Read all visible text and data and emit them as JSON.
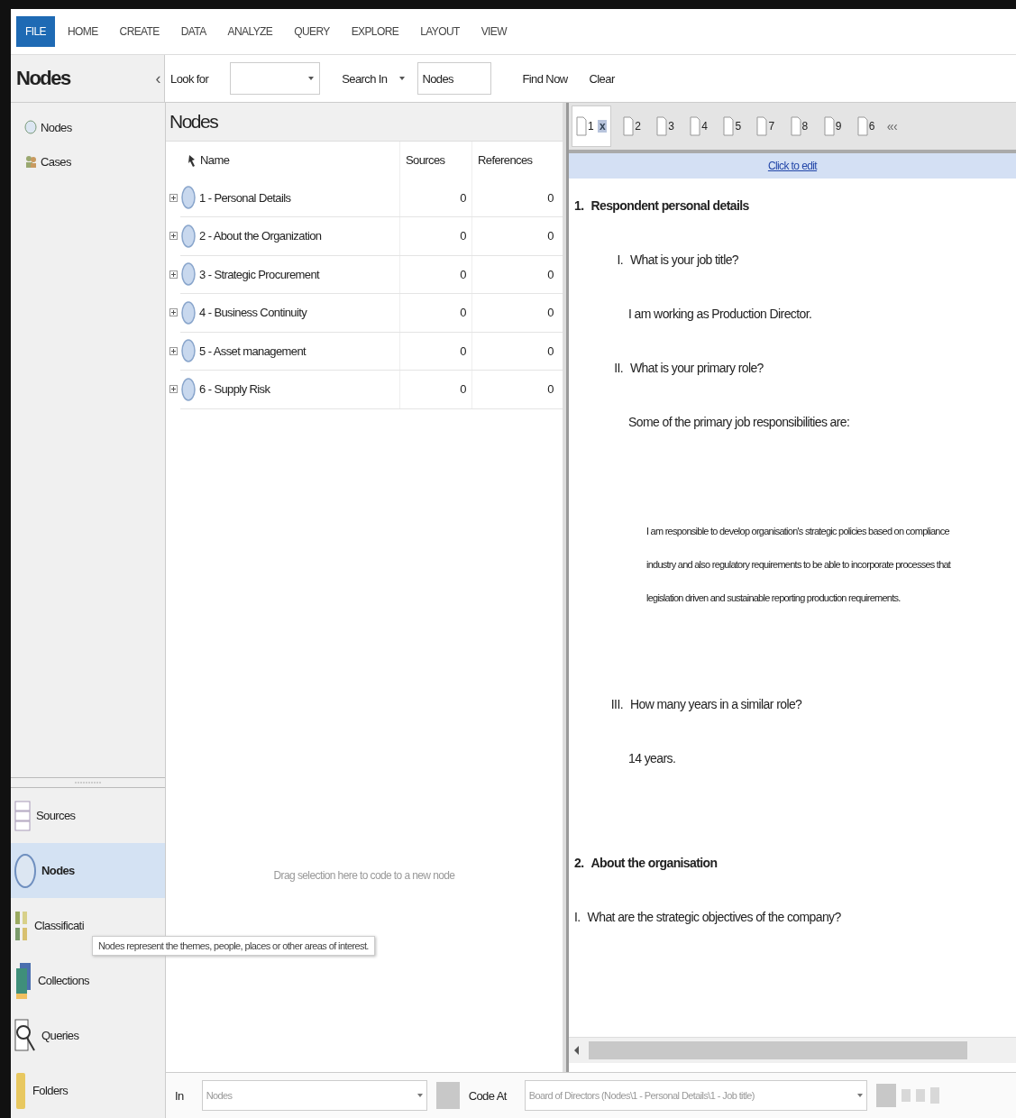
{
  "ribbon_tabs": [
    {
      "label": "FILE",
      "selected": true
    },
    {
      "label": "HOME",
      "selected": false
    },
    {
      "label": "CREATE",
      "selected": false
    },
    {
      "label": "DATA",
      "selected": false
    },
    {
      "label": "ANALYZE",
      "selected": false
    },
    {
      "label": "QUERY",
      "selected": false
    },
    {
      "label": "EXPLORE",
      "selected": false
    },
    {
      "label": "LAYOUT",
      "selected": false
    },
    {
      "label": "VIEW",
      "selected": false
    }
  ],
  "navigation": {
    "title": "Nodes",
    "collapse": "‹",
    "tree": [
      {
        "label": "Nodes",
        "selected": false,
        "kind": "nodes"
      },
      {
        "label": "Cases",
        "selected": false,
        "kind": "cases"
      }
    ],
    "sections": [
      {
        "label": "Sources",
        "selected": false,
        "kind": "sources"
      },
      {
        "label": "Nodes",
        "selected": true,
        "kind": "nodes"
      },
      {
        "label": "Classificati",
        "selected": false,
        "kind": "classifications"
      },
      {
        "label": "Collections",
        "selected": false,
        "kind": "collections"
      },
      {
        "label": "Queries",
        "selected": false,
        "kind": "queries"
      },
      {
        "label": "Folders",
        "selected": false,
        "kind": "folders"
      }
    ]
  },
  "find_bar": {
    "look_for_label": "Look for",
    "search_in_label": "Search In",
    "search_in_value": "Nodes",
    "find_now": "Find Now",
    "clear": "Clear"
  },
  "nodes_list": {
    "title": "Nodes",
    "columns": [
      "Name",
      "Sources",
      "References"
    ],
    "rows": [
      {
        "name": "1 - Personal Details",
        "sources": "0",
        "references": "0"
      },
      {
        "name": "2 - About the Organization",
        "sources": "0",
        "references": "0"
      },
      {
        "name": "3 - Strategic Procurement",
        "sources": "0",
        "references": "0"
      },
      {
        "name": "4 - Business Continuity",
        "sources": "0",
        "references": "0"
      },
      {
        "name": "5 - Asset management",
        "sources": "0",
        "references": "0"
      },
      {
        "name": "6 - Supply Risk",
        "sources": "0",
        "references": "0"
      }
    ],
    "drop_hint": "Drag selection here to code to a new node"
  },
  "tooltip": "Nodes represent the themes, people, places or other areas of interest.",
  "document": {
    "tabs": [
      {
        "label": "1",
        "selected": true,
        "close": "x"
      },
      {
        "label": "2",
        "selected": false
      },
      {
        "label": "3",
        "selected": false
      },
      {
        "label": "4",
        "selected": false
      },
      {
        "label": "5",
        "selected": false
      },
      {
        "label": "7",
        "selected": false
      },
      {
        "label": "8",
        "selected": false
      },
      {
        "label": "9",
        "selected": false
      },
      {
        "label": "6",
        "selected": false
      }
    ],
    "tab_scroll": "«‹",
    "edit_bar": "Click to edit",
    "content": [
      {
        "kind": "heading",
        "number": "1.",
        "text": "Respondent personal details"
      },
      {
        "kind": "question",
        "number": "I.",
        "text": "What is your job title?"
      },
      {
        "kind": "answer",
        "text": "I am working as Production Director."
      },
      {
        "kind": "question",
        "number": "II.",
        "text": "What is your primary role?"
      },
      {
        "kind": "answer",
        "text": "Some of the primary job responsibilities are:"
      },
      {
        "kind": "paragraph",
        "lines": [
          "I am responsible to develop organisation's strategic policies based on compliance",
          "industry and also regulatory requirements to be able to incorporate processes that",
          "legislation driven and sustainable reporting production requirements."
        ]
      },
      {
        "kind": "question",
        "number": "III.",
        "text": "How many years in a similar role?"
      },
      {
        "kind": "answer",
        "text": "14 years."
      },
      {
        "kind": "heading",
        "number": "2.",
        "text": "About the organisation"
      },
      {
        "kind": "plain_question",
        "number": "I.",
        "text": "What are the strategic objectives of the company?"
      }
    ]
  },
  "coding_bar": {
    "in_label": "In",
    "in_placeholder": "Nodes",
    "code_at_label": "Code At",
    "code_at_value": "Board of Directors (Nodes\\1 - Personal Details\\1 - Job title)"
  }
}
